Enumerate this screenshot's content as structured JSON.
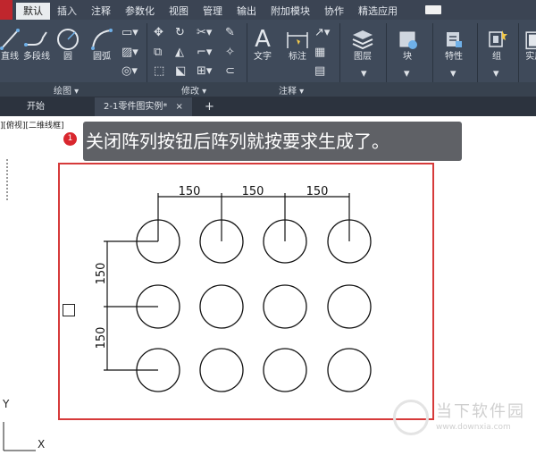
{
  "menu_tabs": [
    "默认",
    "插入",
    "注释",
    "参数化",
    "视图",
    "管理",
    "输出",
    "附加模块",
    "协作",
    "精选应用"
  ],
  "ribbon": {
    "draw_tools": [
      "直线",
      "多段线",
      "圆",
      "圆弧"
    ],
    "text_tool": "文字",
    "dimension_tool": "标注",
    "layers_tool": "图层",
    "block_tool": "块",
    "properties_tool": "特性",
    "group_tool": "组",
    "utilities_tool": "实用",
    "group_labels": [
      "绘图 ▾",
      "修改 ▾",
      "注释 ▾"
    ]
  },
  "doc_tabs": {
    "start": "开始",
    "current": "2-1零件图实例*",
    "close": "×",
    "add": "+"
  },
  "viewport_label": "][俯视][二维线框]",
  "tooltip": {
    "badge": "1",
    "text": "关闭阵列按钮后阵列就按要求生成了。"
  },
  "drawing": {
    "dims_horizontal": [
      "150",
      "150",
      "150"
    ],
    "dims_vertical": [
      "150",
      "150"
    ],
    "rows": 3,
    "cols": 4
  },
  "ucs": {
    "y": "Y",
    "x": "X"
  },
  "watermark": {
    "name": "当下软件园",
    "url": "www.downxia.com"
  },
  "colors": {
    "ribbon_bg": "#3f4a5a",
    "highlight_box": "#d63a3a",
    "badge": "#d9272e",
    "tooltip_bg": "#5f6166"
  }
}
